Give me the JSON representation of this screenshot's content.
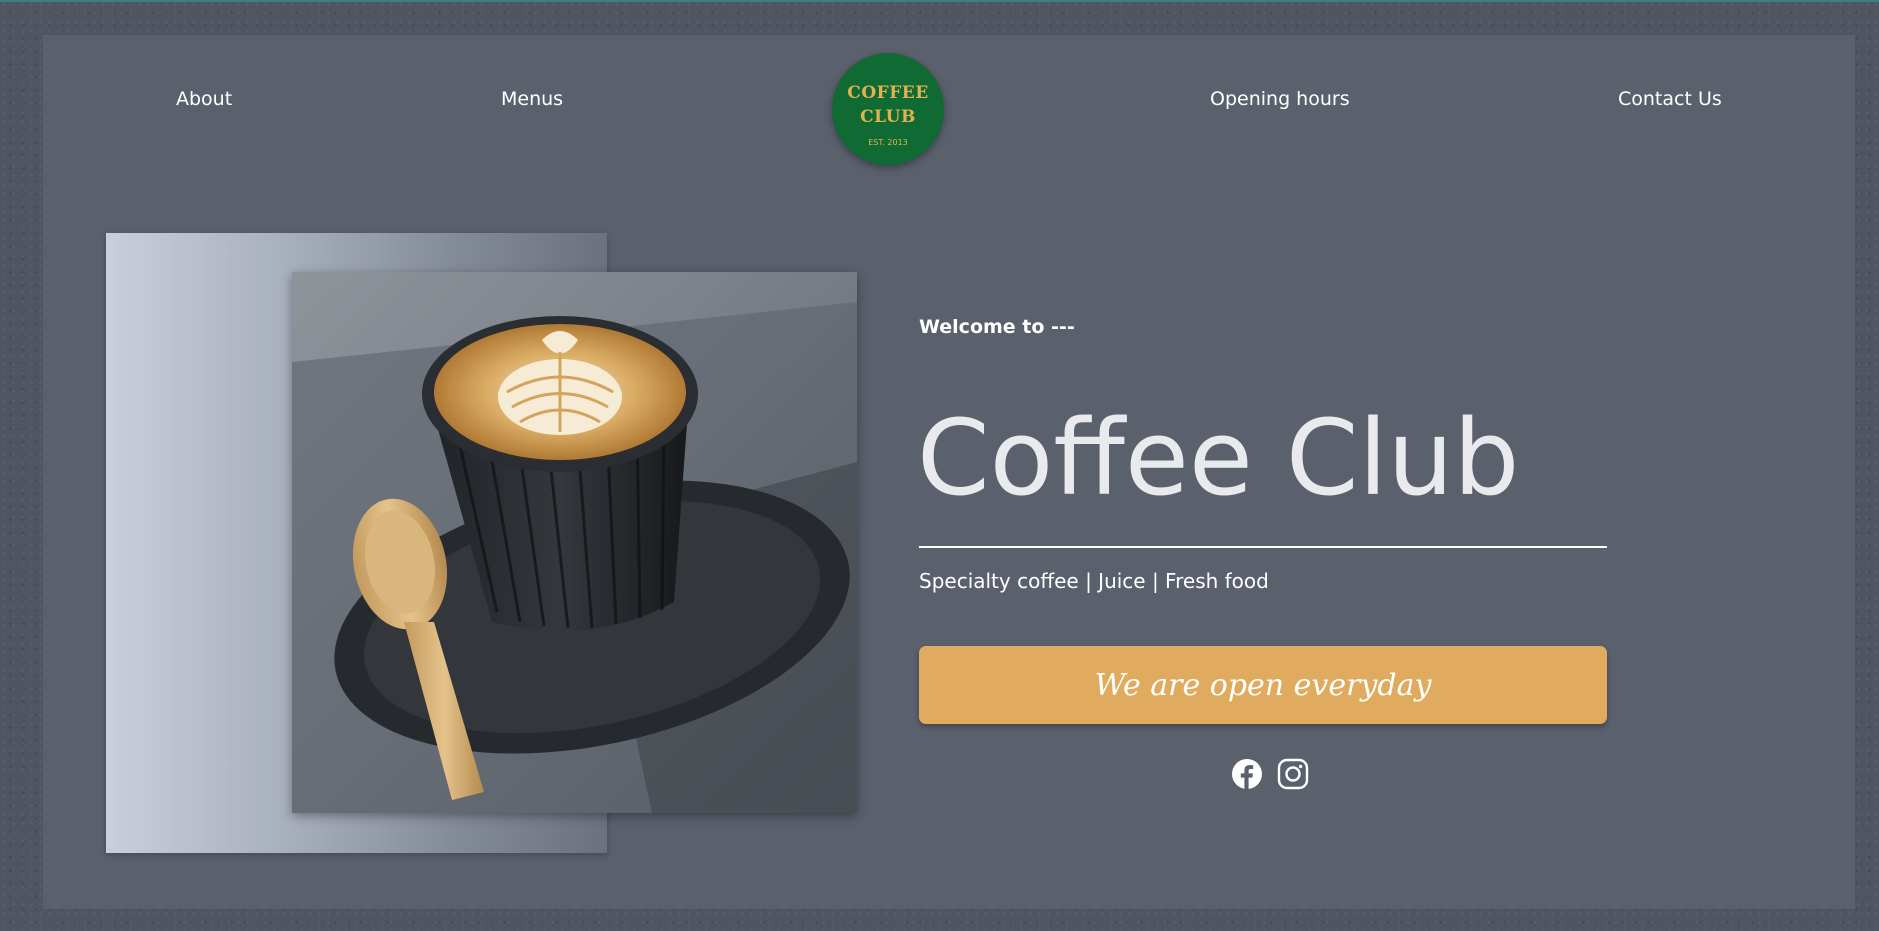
{
  "nav": {
    "about": "About",
    "menus": "Menus",
    "opening_hours": "Opening hours",
    "contact": "Contact Us"
  },
  "logo": {
    "line1": "COFFEE",
    "line2": "CLUB",
    "est": "EST. 2013"
  },
  "hero": {
    "welcome": "Welcome to ---",
    "title": "Coffee Club",
    "subtitle": "Specialty coffee | Juice | Fresh food",
    "cta_label": "We are open everyday"
  },
  "social": {
    "icons": [
      "facebook-icon",
      "instagram-icon"
    ]
  },
  "colors": {
    "page_background": "#505561",
    "panel": "#5b606d",
    "logo_green": "#0f6b33",
    "logo_gold": "#e3b250",
    "cta": "#e0ab5e",
    "text": "#ffffff"
  }
}
